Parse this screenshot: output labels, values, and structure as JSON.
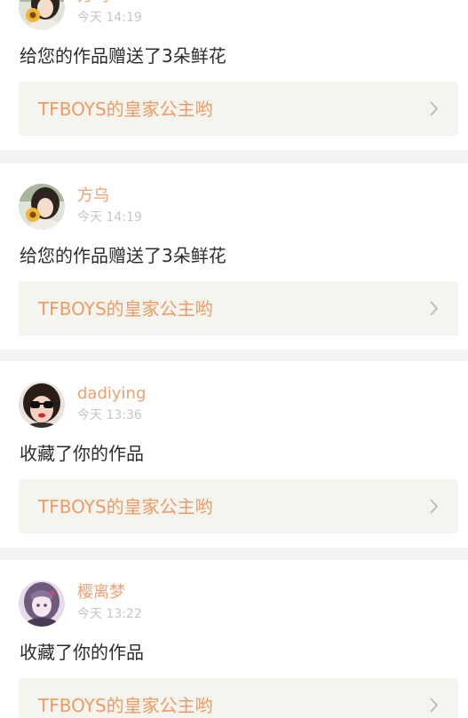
{
  "notifications": [
    {
      "username": "方乌",
      "time": "今天 14:19",
      "message": "给您的作品赠送了3朵鲜花",
      "work_title": "TFBOYS的皇家公主哟",
      "avatar_icon": "girl-with-sunflower-avatar"
    },
    {
      "username": "方乌",
      "time": "今天 14:19",
      "message": "给您的作品赠送了3朵鲜花",
      "work_title": "TFBOYS的皇家公主哟",
      "avatar_icon": "girl-with-sunflower-avatar"
    },
    {
      "username": "dadiying",
      "time": "今天 13:36",
      "message": "收藏了你的作品",
      "work_title": "TFBOYS的皇家公主哟",
      "avatar_icon": "girl-with-sunglasses-avatar"
    },
    {
      "username": "樱离梦",
      "time": "今天 13:22",
      "message": "收藏了你的作品",
      "work_title": "TFBOYS的皇家公主哟",
      "avatar_icon": "anime-girl-avatar"
    }
  ],
  "colors": {
    "username": "#f0a06e",
    "work_title": "#f19a62",
    "time": "#c6c6c6",
    "message": "#2c2c2c",
    "card_background": "#ffffff",
    "link_background": "#f5f5ef",
    "page_background": "#f3f3f3"
  }
}
